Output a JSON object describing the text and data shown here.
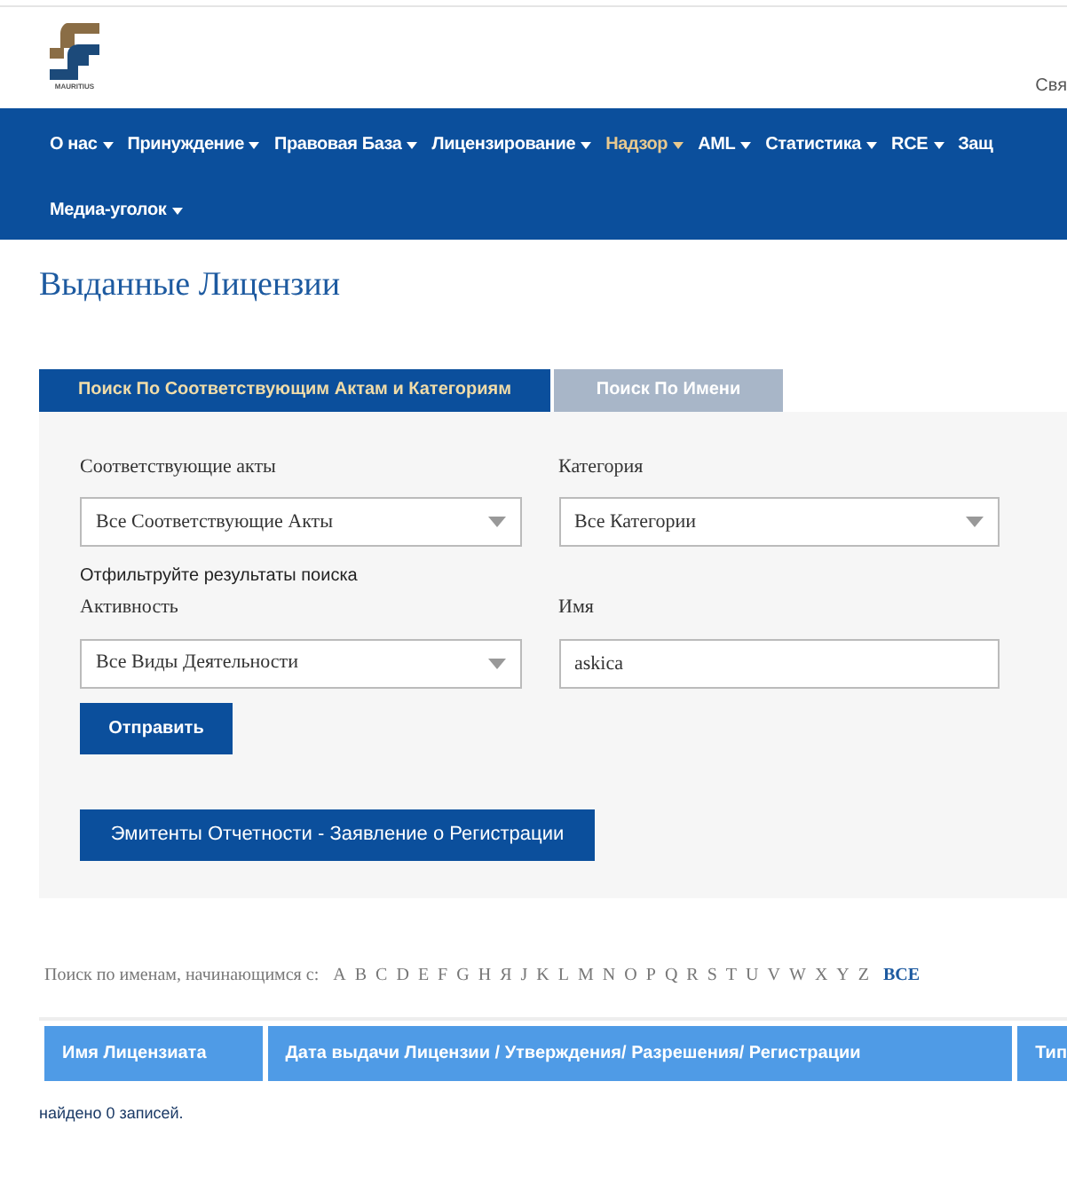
{
  "header": {
    "logo_text": "MAURITIUS",
    "top_link": "Свя"
  },
  "nav": [
    {
      "label": "О нас",
      "selected": false,
      "dropdown": true
    },
    {
      "label": "Принуждение",
      "selected": false,
      "dropdown": true
    },
    {
      "label": "Правовая База",
      "selected": false,
      "dropdown": true
    },
    {
      "label": "Лицензирование",
      "selected": false,
      "dropdown": true
    },
    {
      "label": "Надзор",
      "selected": true,
      "dropdown": true
    },
    {
      "label": "AML",
      "selected": false,
      "dropdown": true
    },
    {
      "label": "Статистика",
      "selected": false,
      "dropdown": true
    },
    {
      "label": "RCE",
      "selected": false,
      "dropdown": true
    },
    {
      "label": "Защ",
      "selected": false,
      "dropdown": false
    },
    {
      "label": "Медиа-уголок",
      "selected": false,
      "dropdown": true
    }
  ],
  "page_title": "Выданные Лицензии",
  "tabs": [
    {
      "label": "Поиск По Соответствующим Актам и Категориям",
      "selected": true
    },
    {
      "label": "Поиск По Имени",
      "selected": false
    }
  ],
  "form": {
    "fields": [
      {
        "label": "Соответствующие акты",
        "kind": "select",
        "value": "Все Соответствующие Акты"
      },
      {
        "label": "Категория",
        "kind": "select",
        "value": "Все Категории"
      },
      {
        "label": "Активность",
        "kind": "select",
        "value": "Все Виды Деятельности"
      },
      {
        "label": "Имя",
        "kind": "text",
        "value": "askica"
      }
    ],
    "filter_note": "Отфильтруйте результаты поиска",
    "submit": "Отправить",
    "secondary_button": "Эмитенты Отчетности - Заявление о Регистрации"
  },
  "alphabet": {
    "label": "Поиск по именам, начинающимся с:",
    "letters": [
      "A",
      "B",
      "C",
      "D",
      "E",
      "F",
      "G",
      "H",
      "Я",
      "J",
      "K",
      "L",
      "M",
      "N",
      "O",
      "P",
      "Q",
      "R",
      "S",
      "T",
      "U",
      "V",
      "W",
      "X",
      "Y",
      "Z"
    ],
    "all": "ВСЕ"
  },
  "table": {
    "columns": [
      "Имя Лицензиата",
      "Дата выдачи Лицензии / Утверждения/ Разрешения/ Регистрации",
      "Тип"
    ]
  },
  "result": "найдено 0 записей."
}
